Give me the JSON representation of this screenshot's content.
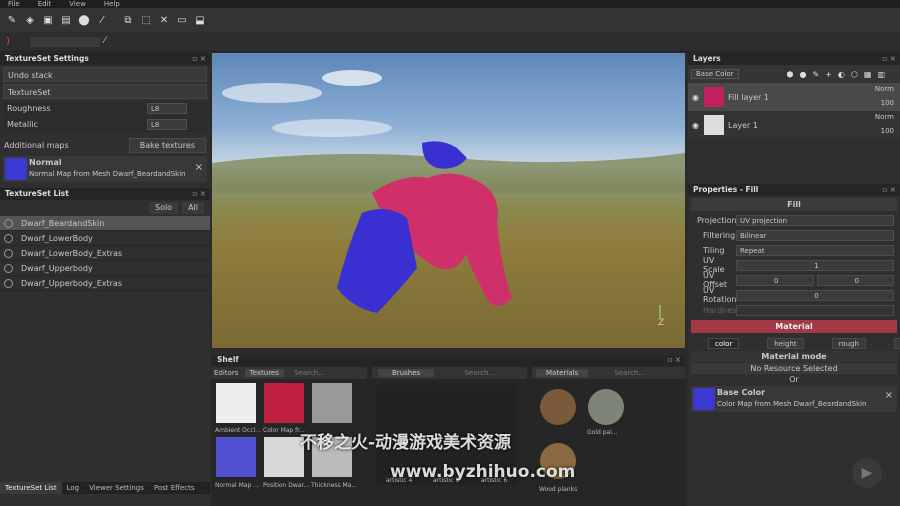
{
  "menu": [
    "File",
    "Edit",
    "View",
    "Help"
  ],
  "textureset_settings": {
    "title": "TextureSet Settings",
    "undo_stack": "Undo stack",
    "textureset_btn": "TextureSet",
    "props": [
      {
        "label": "Roughness",
        "value": "L8"
      },
      {
        "label": "Metallic",
        "value": "L8"
      }
    ],
    "additional_maps": "Additional maps",
    "bake_textures": "Bake textures",
    "map_name": "Normal",
    "map_desc": "Normal Map from Mesh Dwarf_BeardandSkin"
  },
  "textureset_list": {
    "title": "TextureSet List",
    "solo": "Solo",
    "all": "All",
    "items": [
      "Dwarf_BeardandSkin",
      "Dwarf_LowerBody",
      "Dwarf_LowerBody_Extras",
      "Dwarf_Upperbody",
      "Dwarf_Upperbody_Extras"
    ]
  },
  "bottom_tabs": [
    "TextureSet List",
    "Log",
    "Viewer Settings",
    "Post Effects"
  ],
  "layers": {
    "title": "Layers",
    "channel": "Base Color",
    "items": [
      {
        "name": "Fill layer 1",
        "blend": "Norm",
        "opacity": "100"
      },
      {
        "name": "Layer 1",
        "blend": "Norm",
        "opacity": "100"
      }
    ]
  },
  "properties": {
    "title": "Properties - Fill",
    "section_fill": "Fill",
    "projection_label": "Projection",
    "projection_value": "UV projection",
    "filtering_label": "Filtering",
    "filtering_value": "Bilinear",
    "tiling_label": "Tiling",
    "tiling_value": "Repeat",
    "uvscale_label": "UV Scale",
    "uvscale_value": "1",
    "uvoffset_label": "UV Offset",
    "uvoffset_a": "0",
    "uvoffset_b": "0",
    "uvrotation_label": "UV Rotation",
    "uvrotation_value": "0",
    "hardness_label": "Hardness",
    "section_material": "Material",
    "channels": [
      "color",
      "height",
      "rough",
      "metal"
    ],
    "material_mode": "Material mode",
    "no_resource": "No Resource Selected",
    "or": "Or",
    "base_color_title": "Base Color",
    "base_color_desc": "Color Map from Mesh Dwarf_BeardandSkin"
  },
  "shelf": {
    "title": "Shelf",
    "tab_prev": "Editors",
    "tab_textures": "Textures",
    "tab_brushes": "Brushes",
    "tab_materials": "Materials",
    "search_placeholder": "Search...",
    "textures": [
      "Ambient Occl...",
      "Color Map fr...",
      "",
      "Normal Map ...",
      "Position Dwar...",
      "Thickness Ma..."
    ],
    "brushes": [
      "artistic 4",
      "artistic 5",
      "artistic 6"
    ],
    "materials": [
      "",
      "Gold pai...",
      "Wood planks"
    ]
  },
  "watermark": {
    "line1": "不移之火-动漫游戏美术资源",
    "line2": "www.byzhihuo.com"
  },
  "colors": {
    "accent_red": "#a33a46",
    "mesh_pink": "#d0306a",
    "mesh_blue": "#3a2fd0"
  }
}
